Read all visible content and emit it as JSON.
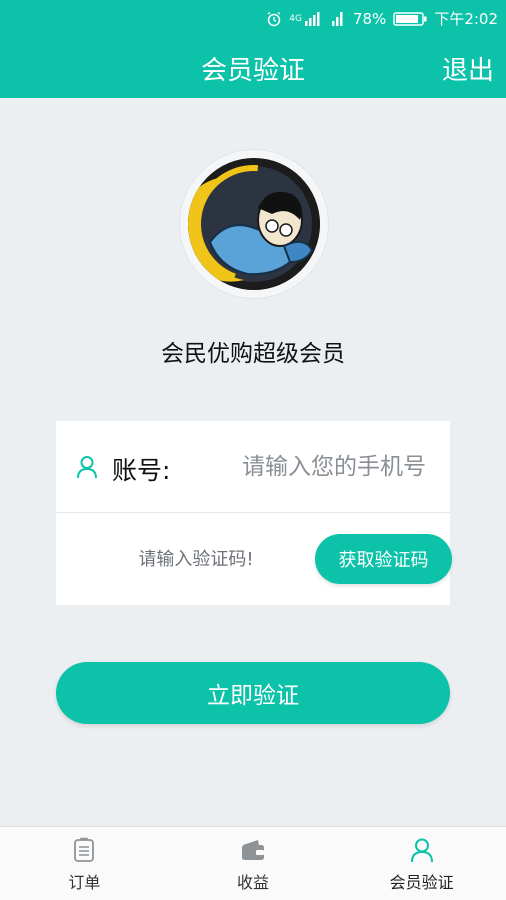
{
  "status_bar": {
    "network": "4G",
    "battery": "78%",
    "time": "下午2:02"
  },
  "header": {
    "title": "会员验证",
    "logout_label": "退出"
  },
  "profile": {
    "member_name": "会民优购超级会员"
  },
  "form": {
    "account_label": "账号:",
    "account_placeholder": "请输入您的手机号",
    "account_value": "",
    "code_placeholder": "请输入验证码!",
    "code_value": "",
    "get_code_label": "获取验证码"
  },
  "verify_button_label": "立即验证",
  "bottom_nav": {
    "items": [
      {
        "label": "订单",
        "icon": "order-list-icon",
        "active": false
      },
      {
        "label": "收益",
        "icon": "wallet-icon",
        "active": false
      },
      {
        "label": "会员验证",
        "icon": "user-icon",
        "active": true
      }
    ]
  },
  "colors": {
    "accent": "#0cc2a8",
    "background": "#eceff2",
    "nav_inactive_icon": "#8e9398"
  }
}
